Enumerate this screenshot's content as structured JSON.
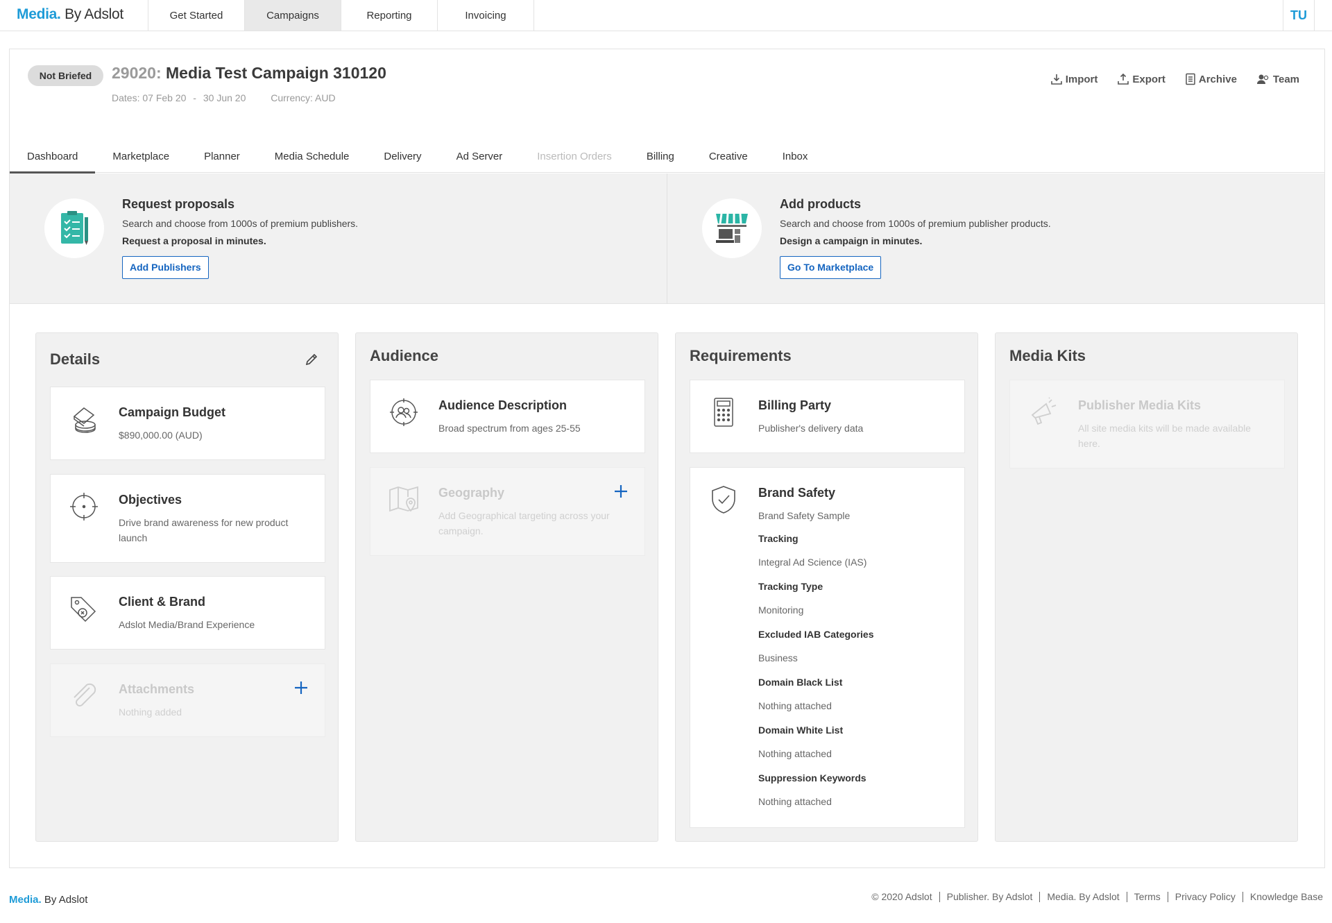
{
  "app": {
    "brand_primary": "Media.",
    "brand_secondary": " By Adslot",
    "accent_color": "#1e9bd7"
  },
  "topnav": [
    {
      "label": "Get Started",
      "active": false
    },
    {
      "label": "Campaigns",
      "active": true
    },
    {
      "label": "Reporting",
      "active": false
    },
    {
      "label": "Invoicing",
      "active": false
    }
  ],
  "user": {
    "initials": "TU"
  },
  "campaign": {
    "status": "Not Briefed",
    "id": "29020:",
    "name": "Media Test Campaign 310120",
    "dates_label": "Dates: 07 Feb 20",
    "dates_separator": "-",
    "dates_end": "30 Jun 20",
    "currency_label": "Currency: AUD"
  },
  "actions": [
    {
      "label": "Import",
      "icon": "import-icon"
    },
    {
      "label": "Export",
      "icon": "export-icon"
    },
    {
      "label": "Archive",
      "icon": "archive-icon"
    },
    {
      "label": "Team",
      "icon": "team-icon"
    }
  ],
  "subtabs": [
    {
      "label": "Dashboard",
      "active": true,
      "disabled": false
    },
    {
      "label": "Marketplace",
      "active": false,
      "disabled": false
    },
    {
      "label": "Planner",
      "active": false,
      "disabled": false
    },
    {
      "label": "Media Schedule",
      "active": false,
      "disabled": false
    },
    {
      "label": "Delivery",
      "active": false,
      "disabled": false
    },
    {
      "label": "Ad Server",
      "active": false,
      "disabled": false
    },
    {
      "label": "Insertion Orders",
      "active": false,
      "disabled": true
    },
    {
      "label": "Billing",
      "active": false,
      "disabled": false
    },
    {
      "label": "Creative",
      "active": false,
      "disabled": false
    },
    {
      "label": "Inbox",
      "active": false,
      "disabled": false
    }
  ],
  "promos": {
    "proposals": {
      "title": "Request proposals",
      "desc": "Search and choose from 1000s of premium publishers.",
      "strong": "Request a proposal in minutes.",
      "button": "Add Publishers",
      "icon": "checklist-icon"
    },
    "products": {
      "title": "Add products",
      "desc": "Search and choose from 1000s of premium publisher products.",
      "strong": "Design a campaign in minutes.",
      "button": "Go To Marketplace",
      "icon": "storefront-icon"
    }
  },
  "details": {
    "title": "Details",
    "budget": {
      "title": "Campaign Budget",
      "value": "$890,000.00 (AUD)"
    },
    "objectives": {
      "title": "Objectives",
      "value": "Drive brand awareness for new product launch"
    },
    "client": {
      "title": "Client & Brand",
      "value": "Adslot Media/Brand Experience"
    },
    "attachments": {
      "title": "Attachments",
      "value": "Nothing added"
    }
  },
  "audience": {
    "title": "Audience",
    "description": {
      "title": "Audience Description",
      "value": "Broad spectrum from ages 25-55"
    },
    "geography": {
      "title": "Geography",
      "value": "Add Geographical targeting across your campaign."
    }
  },
  "requirements": {
    "title": "Requirements",
    "billing": {
      "title": "Billing Party",
      "value": "Publisher's delivery data"
    },
    "brand_safety": {
      "title": "Brand Safety",
      "value": "Brand Safety Sample",
      "tracking_label": "Tracking",
      "tracking_value": "Integral Ad Science (IAS)",
      "tracking_type_label": "Tracking Type",
      "tracking_type_value": "Monitoring",
      "iab_label": "Excluded IAB Categories",
      "iab_value": "Business",
      "black_label": "Domain Black List",
      "black_value": "Nothing attached",
      "white_label": "Domain White List",
      "white_value": "Nothing attached",
      "keywords_label": "Suppression Keywords",
      "keywords_value": "Nothing attached"
    }
  },
  "media_kits": {
    "title": "Media Kits",
    "publisher": {
      "title": "Publisher Media Kits",
      "value": "All site media kits will be made available here."
    }
  },
  "footer": {
    "brand_primary": "Media.",
    "brand_secondary": " By Adslot",
    "links": [
      "© 2020 Adslot",
      "Publisher. By Adslot",
      "Media. By Adslot",
      "Terms",
      "Privacy Policy",
      "Knowledge Base"
    ]
  }
}
